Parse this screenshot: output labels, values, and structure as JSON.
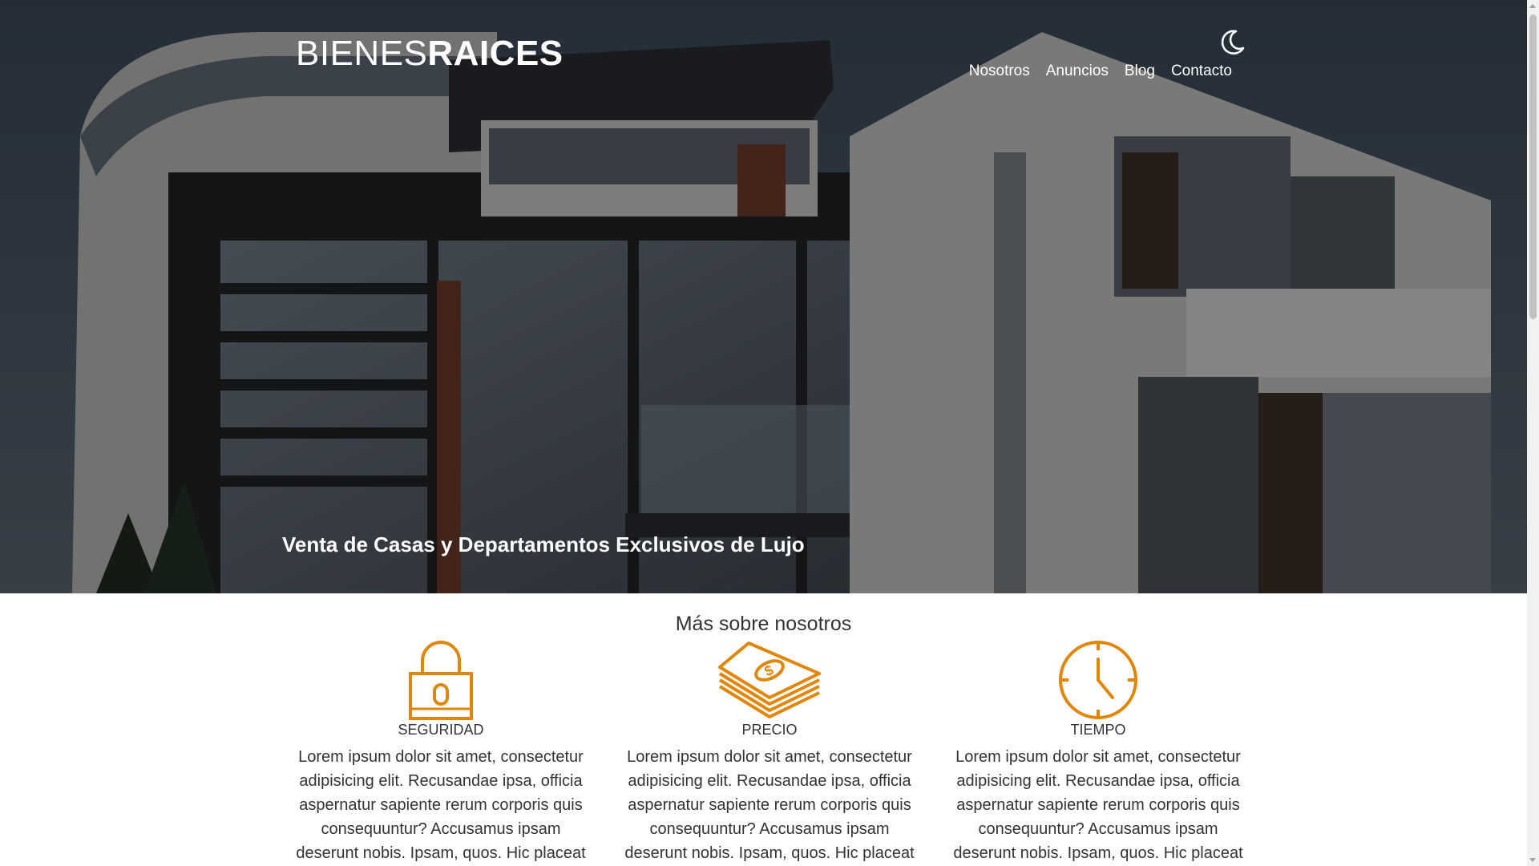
{
  "header": {
    "logo_light": "BIENES",
    "logo_bold": "RAICES",
    "nav": [
      {
        "label": "Nosotros"
      },
      {
        "label": "Anuncios"
      },
      {
        "label": "Blog"
      },
      {
        "label": "Contacto"
      }
    ],
    "theme_toggle_icon": "moon-icon"
  },
  "hero": {
    "title": "Venta de Casas y Departamentos Exclusivos de Lujo"
  },
  "about": {
    "title": "Más sobre nosotros",
    "features": [
      {
        "icon": "lock-icon",
        "label": "SEGURIDAD",
        "text": "Lorem ipsum dolor sit amet, consectetur adipisicing elit. Recusandae ipsa, officia aspernatur sapiente rerum corporis quis consequuntur? Accusamus ipsam deserunt nobis. Ipsam, quos. Hic placeat voluptas"
      },
      {
        "icon": "money-stack-icon",
        "label": "PRECIO",
        "text": "Lorem ipsum dolor sit amet, consectetur adipisicing elit. Recusandae ipsa, officia aspernatur sapiente rerum corporis quis consequuntur? Accusamus ipsam deserunt nobis. Ipsam, quos. Hic placeat voluptas"
      },
      {
        "icon": "clock-icon",
        "label": "TIEMPO",
        "text": "Lorem ipsum dolor sit amet, consectetur adipisicing elit. Recusandae ipsa, officia aspernatur sapiente rerum corporis quis consequuntur? Accusamus ipsam deserunt nobis. Ipsam, quos. Hic placeat voluptas"
      }
    ]
  },
  "colors": {
    "accent": "#e08709",
    "text": "#333333",
    "header_text": "#ffffff"
  }
}
